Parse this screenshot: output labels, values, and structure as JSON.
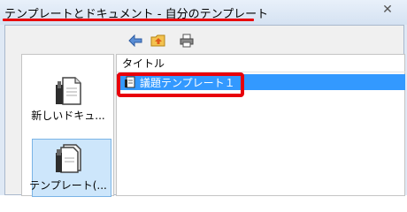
{
  "window": {
    "title": "テンプレートとドキュメント - 自分のテンプレート",
    "close_symbol": "✕"
  },
  "toolbar": {
    "buttons": [
      {
        "icon": "back-arrow-icon"
      },
      {
        "icon": "folder-up-icon"
      },
      {
        "icon": "print-icon"
      }
    ]
  },
  "sidebar": {
    "items": [
      {
        "label": "新しいドキュ...",
        "icon": "new-document-icon",
        "selected": false
      },
      {
        "label": "テンプレート(...",
        "icon": "templates-icon",
        "selected": true
      }
    ]
  },
  "list": {
    "column_header": "タイトル",
    "rows": [
      {
        "label": "議題テンプレート１",
        "icon": "template-file-icon",
        "selected": true
      }
    ]
  },
  "colors": {
    "highlight": "#e8000b",
    "selection": "#3399ff"
  }
}
